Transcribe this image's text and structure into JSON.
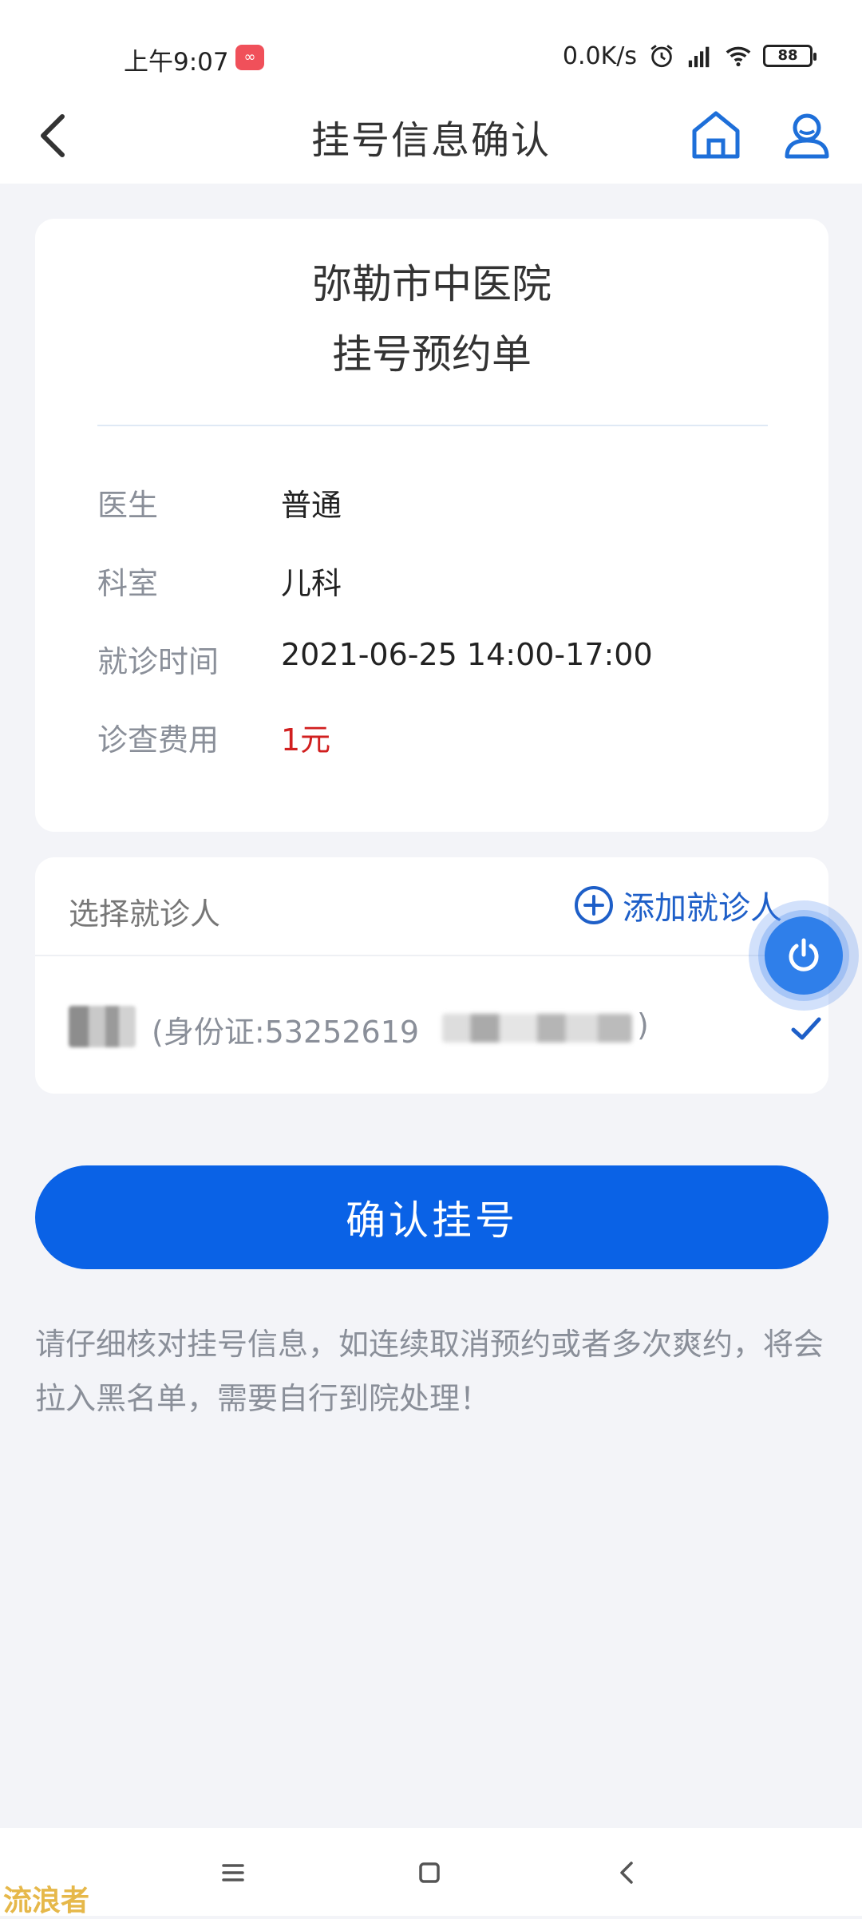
{
  "status_bar": {
    "time": "上午9:07",
    "net_speed": "0.0K/s",
    "battery": "88"
  },
  "nav": {
    "title": "挂号信息确认"
  },
  "order": {
    "hospital": "弥勒市中医院",
    "form_title": "挂号预约单",
    "rows": [
      {
        "label": "医生",
        "value": "普通"
      },
      {
        "label": "科室",
        "value": "儿科"
      },
      {
        "label": "就诊时间",
        "value": "2021-06-25 14:00-17:00"
      },
      {
        "label": "诊查费用",
        "value": "1元"
      }
    ],
    "fee_color": "#d11f1f"
  },
  "patient": {
    "select_label": "选择就诊人",
    "add_label": "添加就诊人",
    "id_text": "(身份证:53252619",
    "id_close": ")"
  },
  "actions": {
    "confirm_label": "确认挂号"
  },
  "notice": "请仔细核对挂号信息，如连续取消预约或者多次爽约，将会拉入黑名单，需要自行到院处理！",
  "watermark": "流浪者",
  "colors": {
    "primary": "#0a62e6",
    "accent_blue": "#1e5fc8",
    "background": "#f3f4f8"
  }
}
